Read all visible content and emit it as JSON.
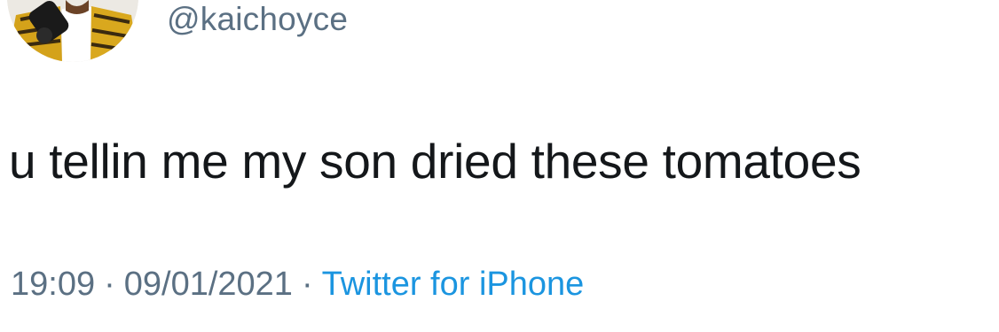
{
  "tweet": {
    "handle": "@kaichoyce",
    "text": "u tellin me my son dried these tomatoes",
    "time": "19:09",
    "date": "09/01/2021",
    "separator": "·",
    "source": "Twitter for iPhone"
  },
  "colors": {
    "text": "#14171a",
    "secondary": "#5b7083",
    "link": "#1b95e0"
  },
  "icons": {
    "avatar": "profile-photo"
  }
}
